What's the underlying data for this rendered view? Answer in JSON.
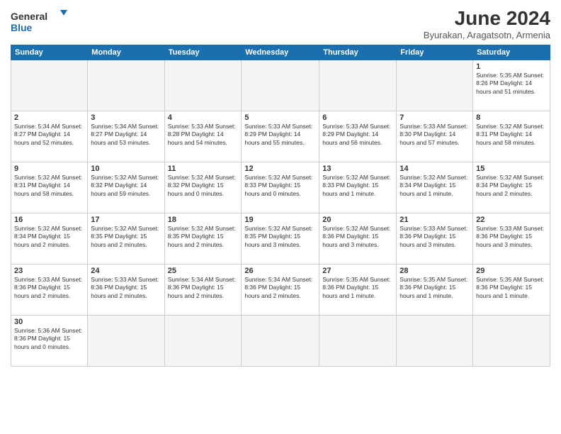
{
  "logo": {
    "text_general": "General",
    "text_blue": "Blue"
  },
  "title": "June 2024",
  "subtitle": "Byurakan, Aragatsotn, Armenia",
  "weekdays": [
    "Sunday",
    "Monday",
    "Tuesday",
    "Wednesday",
    "Thursday",
    "Friday",
    "Saturday"
  ],
  "weeks": [
    [
      {
        "day": "",
        "info": ""
      },
      {
        "day": "",
        "info": ""
      },
      {
        "day": "",
        "info": ""
      },
      {
        "day": "",
        "info": ""
      },
      {
        "day": "",
        "info": ""
      },
      {
        "day": "",
        "info": ""
      },
      {
        "day": "1",
        "info": "Sunrise: 5:35 AM\nSunset: 8:26 PM\nDaylight: 14 hours and 51 minutes."
      }
    ],
    [
      {
        "day": "2",
        "info": "Sunrise: 5:34 AM\nSunset: 8:27 PM\nDaylight: 14 hours and 52 minutes."
      },
      {
        "day": "3",
        "info": "Sunrise: 5:34 AM\nSunset: 8:27 PM\nDaylight: 14 hours and 53 minutes."
      },
      {
        "day": "4",
        "info": "Sunrise: 5:33 AM\nSunset: 8:28 PM\nDaylight: 14 hours and 54 minutes."
      },
      {
        "day": "5",
        "info": "Sunrise: 5:33 AM\nSunset: 8:29 PM\nDaylight: 14 hours and 55 minutes."
      },
      {
        "day": "6",
        "info": "Sunrise: 5:33 AM\nSunset: 8:29 PM\nDaylight: 14 hours and 56 minutes."
      },
      {
        "day": "7",
        "info": "Sunrise: 5:33 AM\nSunset: 8:30 PM\nDaylight: 14 hours and 57 minutes."
      },
      {
        "day": "8",
        "info": "Sunrise: 5:32 AM\nSunset: 8:31 PM\nDaylight: 14 hours and 58 minutes."
      }
    ],
    [
      {
        "day": "9",
        "info": "Sunrise: 5:32 AM\nSunset: 8:31 PM\nDaylight: 14 hours and 58 minutes."
      },
      {
        "day": "10",
        "info": "Sunrise: 5:32 AM\nSunset: 8:32 PM\nDaylight: 14 hours and 59 minutes."
      },
      {
        "day": "11",
        "info": "Sunrise: 5:32 AM\nSunset: 8:32 PM\nDaylight: 15 hours and 0 minutes."
      },
      {
        "day": "12",
        "info": "Sunrise: 5:32 AM\nSunset: 8:33 PM\nDaylight: 15 hours and 0 minutes."
      },
      {
        "day": "13",
        "info": "Sunrise: 5:32 AM\nSunset: 8:33 PM\nDaylight: 15 hours and 1 minute."
      },
      {
        "day": "14",
        "info": "Sunrise: 5:32 AM\nSunset: 8:34 PM\nDaylight: 15 hours and 1 minute."
      },
      {
        "day": "15",
        "info": "Sunrise: 5:32 AM\nSunset: 8:34 PM\nDaylight: 15 hours and 2 minutes."
      }
    ],
    [
      {
        "day": "16",
        "info": "Sunrise: 5:32 AM\nSunset: 8:34 PM\nDaylight: 15 hours and 2 minutes."
      },
      {
        "day": "17",
        "info": "Sunrise: 5:32 AM\nSunset: 8:35 PM\nDaylight: 15 hours and 2 minutes."
      },
      {
        "day": "18",
        "info": "Sunrise: 5:32 AM\nSunset: 8:35 PM\nDaylight: 15 hours and 2 minutes."
      },
      {
        "day": "19",
        "info": "Sunrise: 5:32 AM\nSunset: 8:35 PM\nDaylight: 15 hours and 3 minutes."
      },
      {
        "day": "20",
        "info": "Sunrise: 5:32 AM\nSunset: 8:36 PM\nDaylight: 15 hours and 3 minutes."
      },
      {
        "day": "21",
        "info": "Sunrise: 5:33 AM\nSunset: 8:36 PM\nDaylight: 15 hours and 3 minutes."
      },
      {
        "day": "22",
        "info": "Sunrise: 5:33 AM\nSunset: 8:36 PM\nDaylight: 15 hours and 3 minutes."
      }
    ],
    [
      {
        "day": "23",
        "info": "Sunrise: 5:33 AM\nSunset: 8:36 PM\nDaylight: 15 hours and 2 minutes."
      },
      {
        "day": "24",
        "info": "Sunrise: 5:33 AM\nSunset: 8:36 PM\nDaylight: 15 hours and 2 minutes."
      },
      {
        "day": "25",
        "info": "Sunrise: 5:34 AM\nSunset: 8:36 PM\nDaylight: 15 hours and 2 minutes."
      },
      {
        "day": "26",
        "info": "Sunrise: 5:34 AM\nSunset: 8:36 PM\nDaylight: 15 hours and 2 minutes."
      },
      {
        "day": "27",
        "info": "Sunrise: 5:35 AM\nSunset: 8:36 PM\nDaylight: 15 hours and 1 minute."
      },
      {
        "day": "28",
        "info": "Sunrise: 5:35 AM\nSunset: 8:36 PM\nDaylight: 15 hours and 1 minute."
      },
      {
        "day": "29",
        "info": "Sunrise: 5:35 AM\nSunset: 8:36 PM\nDaylight: 15 hours and 1 minute."
      }
    ],
    [
      {
        "day": "30",
        "info": "Sunrise: 5:36 AM\nSunset: 8:36 PM\nDaylight: 15 hours and 0 minutes."
      },
      {
        "day": "",
        "info": ""
      },
      {
        "day": "",
        "info": ""
      },
      {
        "day": "",
        "info": ""
      },
      {
        "day": "",
        "info": ""
      },
      {
        "day": "",
        "info": ""
      },
      {
        "day": "",
        "info": ""
      }
    ]
  ]
}
